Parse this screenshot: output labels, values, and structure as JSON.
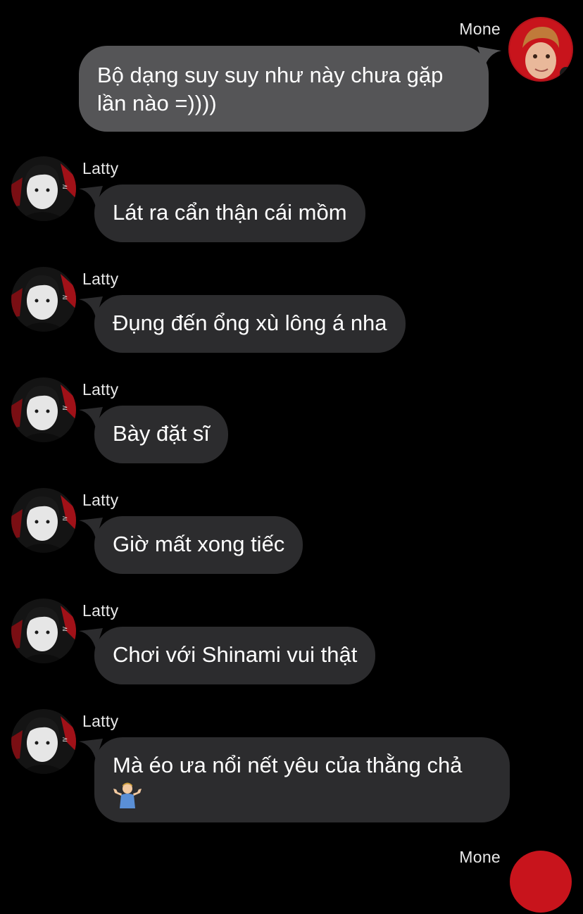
{
  "thread": {
    "messages": [
      {
        "sender": "Mone",
        "direction": "outgoing",
        "text": "Bộ dạng suy suy như này chưa gặp lần nào =))))"
      },
      {
        "sender": "Latty",
        "direction": "incoming",
        "text": "Lát ra cẩn thận cái mồm"
      },
      {
        "sender": "Latty",
        "direction": "incoming",
        "text": "Đụng đến ổng xù lông á nha"
      },
      {
        "sender": "Latty",
        "direction": "incoming",
        "text": "Bày đặt sĩ"
      },
      {
        "sender": "Latty",
        "direction": "incoming",
        "text": "Giờ mất xong tiếc"
      },
      {
        "sender": "Latty",
        "direction": "incoming",
        "text": "Chơi với Shinami vui thật"
      },
      {
        "sender": "Latty",
        "direction": "incoming",
        "text": "Mà éo ưa nổi nết yêu của thằng chả",
        "emoji": "person-shrugging-emoji"
      }
    ],
    "next_sender_partial": "Mone"
  },
  "colors": {
    "background": "#000000",
    "incoming_bubble": "#2c2c2e",
    "outgoing_bubble": "#555557",
    "text": "#ffffff"
  }
}
